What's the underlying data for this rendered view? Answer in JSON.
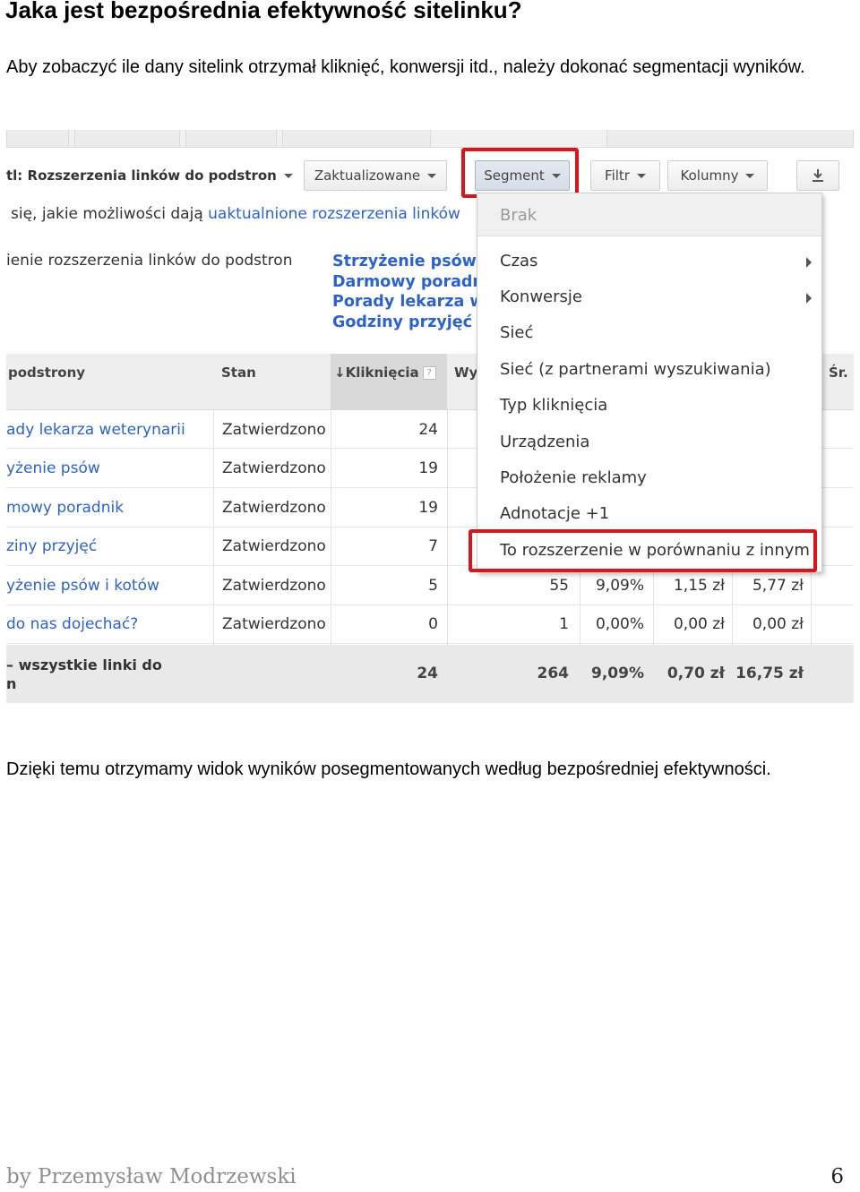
{
  "document": {
    "title": "Jaka jest bezpośrednia efektywność sitelinku?",
    "intro": "Aby zobaczyć ile dany sitelink otrzymał kliknięć, konwersji itd., należy dokonać segmentacji wyników.",
    "outro": "Dzięki temu otrzymamy widok wyników posegmentowanych według bezpośredniej efektywności."
  },
  "footer": {
    "author": "by Przemysław Modrzewski",
    "page": "6"
  },
  "screenshot": {
    "toolbar": {
      "view_label": "tl: Rozszerzenia linków do podstron",
      "zaktualizowane": "Zaktualizowane",
      "segment": "Segment",
      "filtr": "Filtr",
      "kolumny": "Kolumny",
      "download_icon": "download-icon"
    },
    "message": {
      "text": "się, jakie możliwości dają ",
      "link": "uaktualnione rozszerzenia linków"
    },
    "extension_label": "ienie rozszerzenia linków do podstron",
    "sitelinks": [
      "Strzyżenie psów",
      "Darmowy poradn",
      "Porady lekarza w",
      "Godziny przyjęć"
    ],
    "columns": {
      "podstrony": "podstrony",
      "stan": "Stan",
      "klikniecia": "Kliknięcia",
      "help": "?",
      "wy": "Wy",
      "sr": "Śr."
    },
    "rows": [
      {
        "name": "ady lekarza weterynarii",
        "stan": "Zatwierdzono",
        "clicks": "24",
        "impr": "",
        "ctr": "",
        "cpc": "",
        "cost": ""
      },
      {
        "name": "yżenie psów",
        "stan": "Zatwierdzono",
        "clicks": "19",
        "impr": "",
        "ctr": "",
        "cpc": "",
        "cost": ""
      },
      {
        "name": "mowy poradnik",
        "stan": "Zatwierdzono",
        "clicks": "19",
        "impr": "",
        "ctr": "",
        "cpc": "",
        "cost": ""
      },
      {
        "name": "ziny przyjęć",
        "stan": "Zatwierdzono",
        "clicks": "7",
        "impr": "",
        "ctr": "",
        "cpc": "",
        "cost": ""
      },
      {
        "name": "yżenie psów i kotów",
        "stan": "Zatwierdzono",
        "clicks": "5",
        "impr": "55",
        "ctr": "9,09%",
        "cpc": "1,15 zł",
        "cost": "5,77 zł"
      },
      {
        "name": "do nas dojechać?",
        "stan": "Zatwierdzono",
        "clicks": "0",
        "impr": "1",
        "ctr": "0,00%",
        "cpc": "0,00 zł",
        "cost": "0,00 zł"
      }
    ],
    "totals": {
      "label_line1": "– wszystkie linki do",
      "label_line2": "n",
      "clicks": "24",
      "impr": "264",
      "ctr": "9,09%",
      "cpc": "0,70 zł",
      "cost": "16,75 zł"
    },
    "dropdown": {
      "none": "Brak",
      "items": [
        "Czas",
        "Konwersje",
        "Sieć",
        "Sieć (z partnerami wyszukiwania)",
        "Typ kliknięcia",
        "Urządzenia",
        "Położenie reklamy",
        "Adnotacje +1",
        "To rozszerzenie w porównaniu z innym"
      ]
    },
    "highlight_color": "#d9141b",
    "link_color": "#2d62c9"
  }
}
